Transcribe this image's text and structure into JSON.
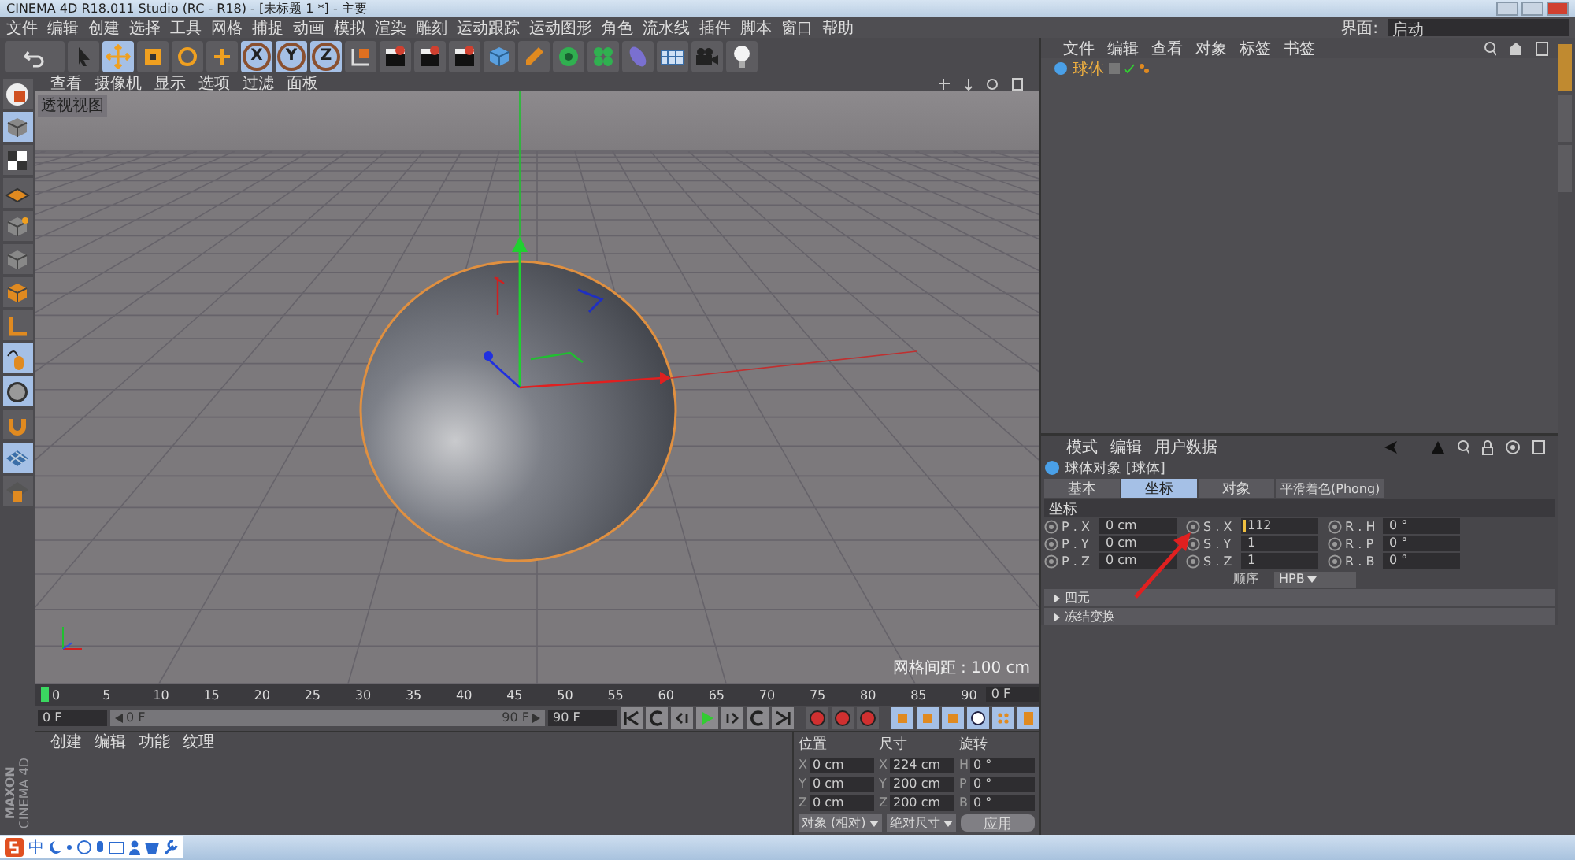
{
  "window": {
    "title": "CINEMA 4D R18.011 Studio (RC - R18) - [未标题 1 *] - 主要"
  },
  "menu": [
    "文件",
    "编辑",
    "创建",
    "选择",
    "工具",
    "网格",
    "捕捉",
    "动画",
    "模拟",
    "渲染",
    "雕刻",
    "运动跟踪",
    "运动图形",
    "角色",
    "流水线",
    "插件",
    "脚本",
    "窗口",
    "帮助"
  ],
  "layout_selector": {
    "label": "界面:",
    "value": "启动"
  },
  "toolbar": [
    {
      "kind": "undo",
      "selected": false
    },
    {
      "kind": "select",
      "selected": false
    },
    {
      "kind": "move",
      "selected": true
    },
    {
      "kind": "scale",
      "selected": false
    },
    {
      "kind": "rotate",
      "selected": false
    },
    {
      "kind": "add",
      "selected": false
    },
    {
      "kind": "axis",
      "label": "X",
      "selected": true
    },
    {
      "kind": "axis",
      "label": "Y",
      "selected": true
    },
    {
      "kind": "axis",
      "label": "Z",
      "selected": true
    },
    {
      "kind": "coords",
      "selected": false
    },
    {
      "kind": "render",
      "selected": false
    },
    {
      "kind": "render",
      "selected": false
    },
    {
      "kind": "render",
      "selected": false
    },
    {
      "kind": "cube",
      "selected": false
    },
    {
      "kind": "pen",
      "selected": false
    },
    {
      "kind": "nurbs",
      "selected": false
    },
    {
      "kind": "cloner",
      "selected": false
    },
    {
      "kind": "deformer",
      "selected": false
    },
    {
      "kind": "floor",
      "selected": false
    },
    {
      "kind": "camera",
      "selected": false
    },
    {
      "kind": "light",
      "selected": false
    }
  ],
  "side_toolbar": [
    {
      "kind": "mode",
      "selected": false
    },
    {
      "kind": "cube",
      "selected": true
    },
    {
      "kind": "texture",
      "selected": false
    },
    {
      "kind": "polygons",
      "selected": false
    },
    {
      "kind": "points",
      "selected": false
    },
    {
      "kind": "edges",
      "selected": false
    },
    {
      "kind": "faces",
      "selected": false
    },
    {
      "kind": "axis",
      "selected": false
    },
    {
      "kind": "tweak",
      "selected": true
    },
    {
      "kind": "snap",
      "selected": true
    },
    {
      "kind": "magnet",
      "selected": false
    },
    {
      "kind": "grid",
      "selected": true
    },
    {
      "kind": "lock",
      "selected": false
    }
  ],
  "viewport": {
    "menu": [
      "查看",
      "摄像机",
      "显示",
      "选项",
      "过滤",
      "面板"
    ],
    "label": "透视视图",
    "grid_spacing": "网格间距 : 100 cm"
  },
  "object_manager": {
    "menu": [
      "文件",
      "编辑",
      "查看",
      "对象",
      "标签",
      "书签"
    ],
    "objects": [
      {
        "name": "球体",
        "selected": true
      }
    ]
  },
  "attributes": {
    "menu": [
      "模式",
      "编辑",
      "用户数据"
    ],
    "object_title": "球体对象 [球体]",
    "tabs": [
      {
        "label": "基本",
        "selected": false
      },
      {
        "label": "坐标",
        "selected": true
      },
      {
        "label": "对象",
        "selected": false
      },
      {
        "label": "平滑着色(Phong)",
        "selected": false
      }
    ],
    "section": "坐标",
    "rows": [
      [
        {
          "label": "P . X",
          "value": "0 cm"
        },
        {
          "label": "S . X",
          "value": "112",
          "editing": true
        },
        {
          "label": "R . H",
          "value": "0 °"
        }
      ],
      [
        {
          "label": "P . Y",
          "value": "0 cm"
        },
        {
          "label": "S . Y",
          "value": "1",
          "editing": false
        },
        {
          "label": "R . P",
          "value": "0 °"
        }
      ],
      [
        {
          "label": "P . Z",
          "value": "0 cm"
        },
        {
          "label": "S . Z",
          "value": "1",
          "editing": false
        },
        {
          "label": "R . B",
          "value": "0 °"
        }
      ]
    ],
    "order_label": "顺序",
    "order_value": "HPB",
    "groups": [
      "四元",
      "冻结变换"
    ]
  },
  "side_tabs": [
    {
      "selected": true
    },
    {
      "selected": false
    },
    {
      "selected": false
    }
  ],
  "timeline": {
    "level": 1,
    "ticks": [
      "0",
      "5",
      "10",
      "15",
      "20",
      "25",
      "30",
      "35",
      "40",
      "45",
      "50",
      "55",
      "60",
      "65",
      "70",
      "75",
      "80",
      "85",
      "90"
    ],
    "end_frame": "0 F",
    "start": "0 F",
    "range_start": "0 F",
    "range_end": "90 F",
    "end": "90 F"
  },
  "materials": {
    "menu": [
      "创建",
      "编辑",
      "功能",
      "纹理"
    ]
  },
  "coordinates": {
    "headers": [
      "位置",
      "尺寸",
      "旋转"
    ],
    "rows": [
      [
        {
          "axis": "X",
          "value": "0 cm"
        },
        {
          "axis": "X",
          "value": "224 cm"
        },
        {
          "axis": "H",
          "value": "0 °"
        }
      ],
      [
        {
          "axis": "Y",
          "value": "0 cm"
        },
        {
          "axis": "Y",
          "value": "200 cm"
        },
        {
          "axis": "P",
          "value": "0 °"
        }
      ],
      [
        {
          "axis": "Z",
          "value": "0 cm"
        },
        {
          "axis": "Z",
          "value": "200 cm"
        },
        {
          "axis": "B",
          "value": "0 °"
        }
      ]
    ],
    "mode": "对象 (相对)",
    "size_mode": "绝对尺寸",
    "apply": "应用"
  },
  "brand": {
    "company": "MAXON",
    "product": "CINEMA 4D"
  },
  "ime_bar": {
    "language": "中"
  }
}
